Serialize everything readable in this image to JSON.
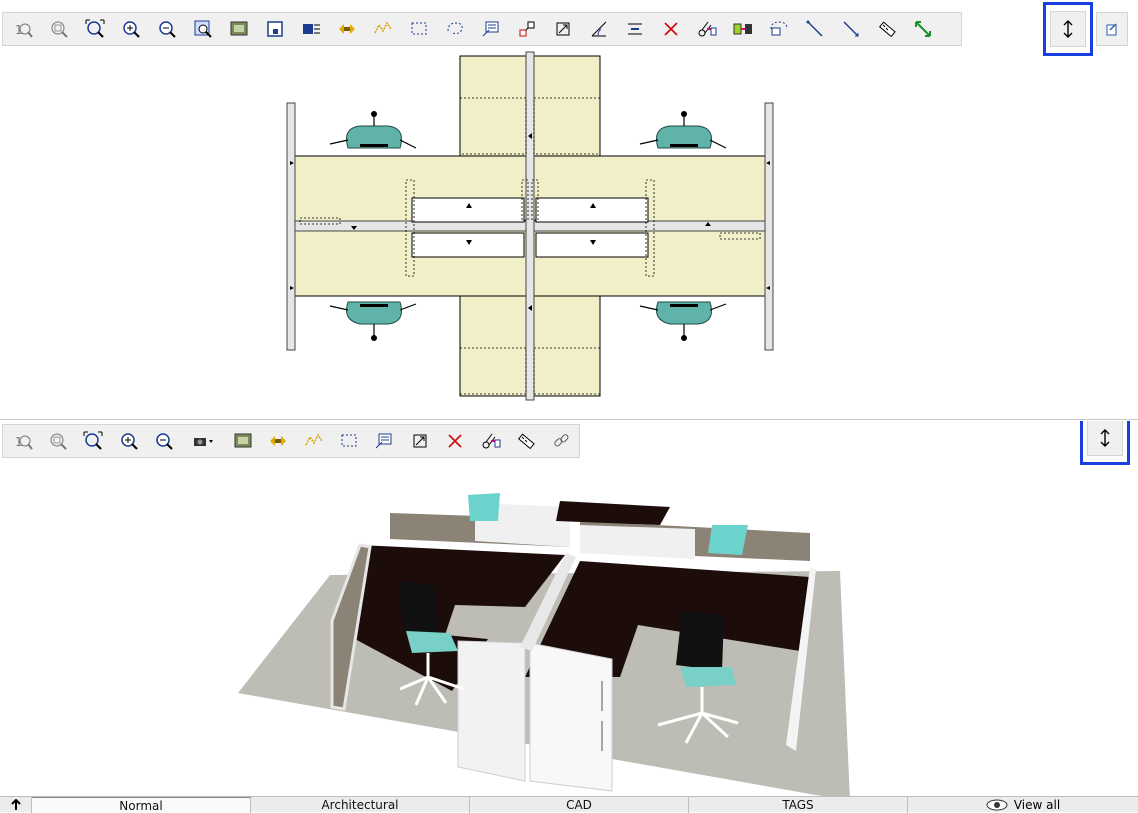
{
  "plan_view": {
    "toolbar": [
      {
        "name": "zoom-1-1-button",
        "icon": "zoom-1-1-icon"
      },
      {
        "name": "zoom-previous-button",
        "icon": "zoom-previous-icon"
      },
      {
        "name": "zoom-extents-button",
        "icon": "zoom-extents-icon"
      },
      {
        "name": "zoom-in-button",
        "icon": "zoom-in-icon"
      },
      {
        "name": "zoom-out-button",
        "icon": "zoom-out-icon"
      },
      {
        "name": "zoom-window-button",
        "icon": "zoom-window-icon"
      },
      {
        "name": "render-button",
        "icon": "render-icon"
      },
      {
        "name": "select-all-button",
        "icon": "select-all-icon"
      },
      {
        "name": "layers-button",
        "icon": "layers-icon"
      },
      {
        "name": "move-horizontal-button",
        "icon": "move-horizontal-icon"
      },
      {
        "name": "polyline-button",
        "icon": "polyline-icon"
      },
      {
        "name": "rectangle-select-button",
        "icon": "rectangle-select-icon"
      },
      {
        "name": "lasso-select-button",
        "icon": "lasso-select-icon"
      },
      {
        "name": "annotate-button",
        "icon": "annotate-icon"
      },
      {
        "name": "connect-button",
        "icon": "connect-icon"
      },
      {
        "name": "rotate-button",
        "icon": "rotate-icon"
      },
      {
        "name": "measure-angle-button",
        "icon": "measure-angle-icon"
      },
      {
        "name": "align-button",
        "icon": "align-icon"
      },
      {
        "name": "delete-button",
        "icon": "delete-icon"
      },
      {
        "name": "cut-paste-button",
        "icon": "cut-paste-icon"
      },
      {
        "name": "replace-button",
        "icon": "replace-icon"
      },
      {
        "name": "group-select-button",
        "icon": "group-select-icon"
      },
      {
        "name": "draw-line-button",
        "icon": "draw-line-icon"
      },
      {
        "name": "dimension-line-button",
        "icon": "dimension-line-icon"
      },
      {
        "name": "ruler-button",
        "icon": "ruler-icon"
      },
      {
        "name": "resize-diagonal-button",
        "icon": "resize-diagonal-icon"
      }
    ],
    "resize_icon": "vertical-resize-icon",
    "extra_icon": "note-icon"
  },
  "view_3d": {
    "toolbar": [
      {
        "name": "zoom-1-1-button",
        "icon": "zoom-1-1-icon"
      },
      {
        "name": "zoom-previous-button",
        "icon": "zoom-previous-icon"
      },
      {
        "name": "zoom-extents-button",
        "icon": "zoom-extents-icon"
      },
      {
        "name": "zoom-in-button",
        "icon": "zoom-in-icon"
      },
      {
        "name": "zoom-out-button",
        "icon": "zoom-out-icon"
      },
      {
        "name": "camera-dropdown-button",
        "icon": "camera-icon"
      },
      {
        "name": "render-button",
        "icon": "render-icon"
      },
      {
        "name": "move-horizontal-button",
        "icon": "move-horizontal-icon"
      },
      {
        "name": "polyline-button",
        "icon": "polyline-icon"
      },
      {
        "name": "rectangle-select-button",
        "icon": "rectangle-select-icon"
      },
      {
        "name": "annotate-button",
        "icon": "annotate-icon"
      },
      {
        "name": "rotate-button",
        "icon": "rotate-icon"
      },
      {
        "name": "delete-button",
        "icon": "delete-icon"
      },
      {
        "name": "cut-paste-button",
        "icon": "cut-paste-icon"
      },
      {
        "name": "ruler-button",
        "icon": "ruler-icon"
      },
      {
        "name": "link-button",
        "icon": "link-icon"
      }
    ],
    "resize_icon": "vertical-resize-icon"
  },
  "status_bar": {
    "pin_icon": "arrow-up-icon",
    "tabs": [
      "Normal",
      "Architectural",
      "CAD",
      "TAGS"
    ],
    "active_tab": "Normal",
    "view_all_label": "View all",
    "view_all_icon": "eye-icon"
  },
  "colors": {
    "desk_top_plan": "#f0efc8",
    "chair_teal": "#5fb3a8",
    "panel_gray": "#d9d9d9",
    "highlight_blue": "#1a3fe0",
    "desk_dark": "#1c0c0a",
    "floor": "#bdbdb5"
  }
}
